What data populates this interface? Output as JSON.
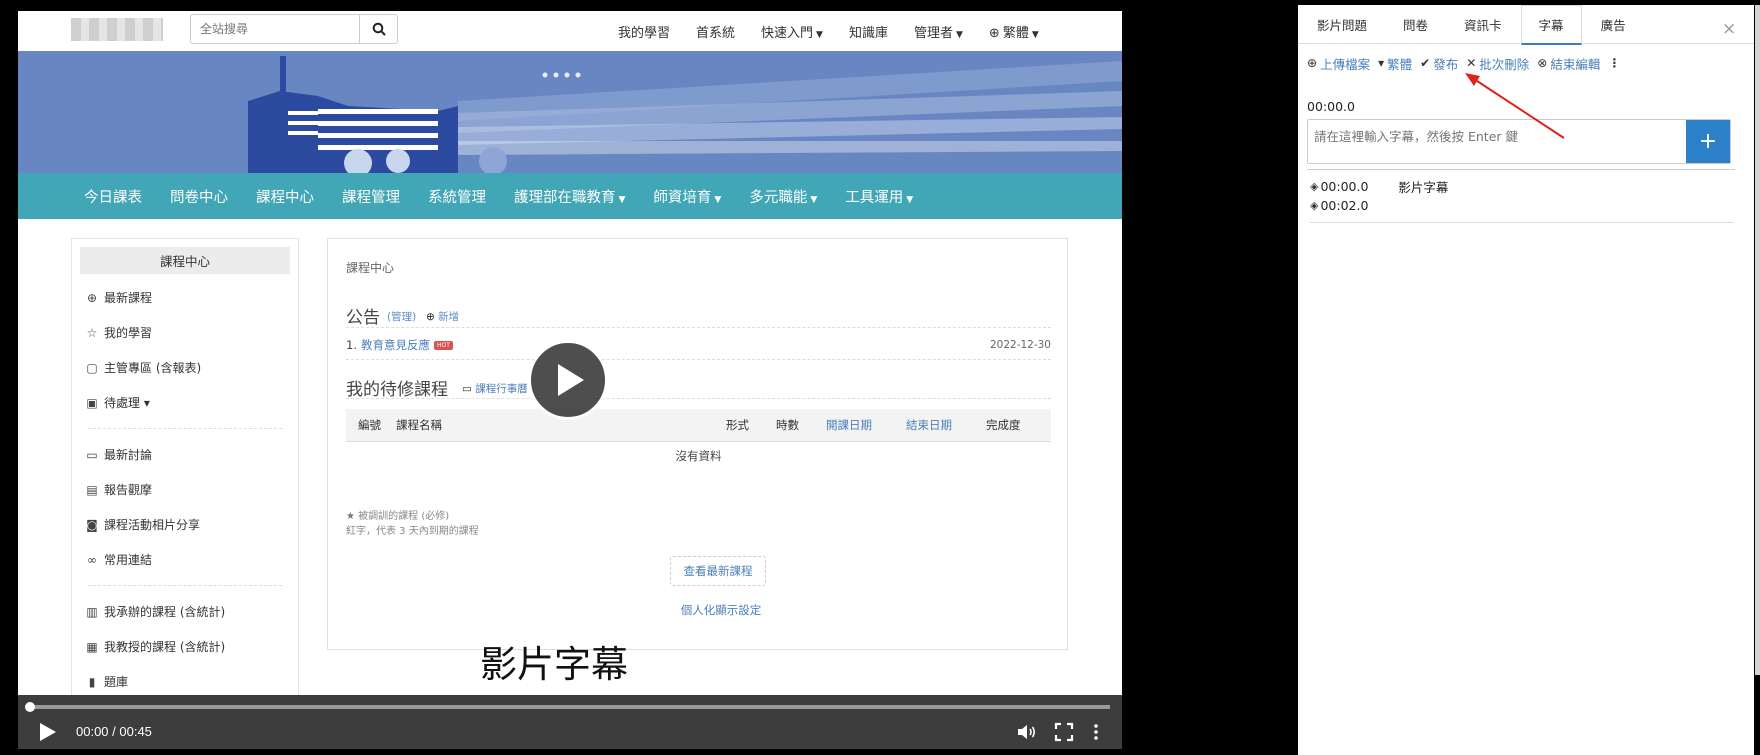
{
  "site": {
    "search_placeholder": "全站搜尋",
    "top_nav": [
      {
        "label": "我的學習",
        "has_caret": false
      },
      {
        "label": "首系統",
        "has_caret": false
      },
      {
        "label": "快速入門",
        "has_caret": true
      },
      {
        "label": "知識庫",
        "has_caret": false
      },
      {
        "label": "管理者",
        "has_caret": true
      },
      {
        "label": "繁體",
        "has_caret": true,
        "globe": true
      }
    ],
    "main_nav": [
      {
        "label": "今日課表",
        "has_caret": false
      },
      {
        "label": "問卷中心",
        "has_caret": false
      },
      {
        "label": "課程中心",
        "has_caret": false
      },
      {
        "label": "課程管理",
        "has_caret": false
      },
      {
        "label": "系統管理",
        "has_caret": false
      },
      {
        "label": "護理部在職教育",
        "has_caret": true
      },
      {
        "label": "師資培育",
        "has_caret": true
      },
      {
        "label": "多元職能",
        "has_caret": true
      },
      {
        "label": "工具運用",
        "has_caret": true
      }
    ],
    "sidebar": {
      "title": "課程中心",
      "groups": [
        [
          {
            "icon": "magnifier-icon",
            "glyph": "⊕",
            "label": "最新課程"
          },
          {
            "icon": "star-icon",
            "glyph": "☆",
            "label": "我的學習"
          },
          {
            "icon": "clipboard-icon",
            "glyph": "▢",
            "label": "主管專區 (含報表)"
          },
          {
            "icon": "briefcase-icon",
            "glyph": "▣",
            "label": "待處理 ▾"
          }
        ],
        [
          {
            "icon": "comment-icon",
            "glyph": "▭",
            "label": "最新討論"
          },
          {
            "icon": "report-icon",
            "glyph": "▤",
            "label": "報告觀摩"
          },
          {
            "icon": "camera-icon",
            "glyph": "◙",
            "label": "課程活動相片分享"
          },
          {
            "icon": "link-icon",
            "glyph": "∞",
            "label": "常用連結"
          }
        ],
        [
          {
            "icon": "files-icon",
            "glyph": "▥",
            "label": "我承辦的課程 (含統計)"
          },
          {
            "icon": "calendar-icon",
            "glyph": "▦",
            "label": "我教授的課程 (含統計)"
          },
          {
            "icon": "books-icon",
            "glyph": "▮",
            "label": "題庫"
          }
        ]
      ]
    },
    "panel": {
      "breadcrumb": "課程中心",
      "announcement_title": "公告",
      "manage_label": "(管理)",
      "new_label": "新增",
      "announcement": {
        "index": "1.",
        "title": "教育意見反應",
        "badge": "HOT",
        "date": "2022-12-30"
      },
      "todo_title": "我的待修課程",
      "calendar_label": "課程行事曆",
      "table_headers": [
        "編號",
        "課程名稱",
        "形式",
        "時數",
        "開課日期",
        "結束日期",
        "完成度"
      ],
      "empty_text": "沒有資料",
      "legend_star": "被調訓的課程 (必修)",
      "legend_red": "紅字，代表 3 天內到期的課程",
      "view_latest": "查看最新課程",
      "personal_settings": "個人化顯示設定"
    }
  },
  "player": {
    "subtitle_overlay": "影片字幕",
    "time_display": "00:00 / 00:45",
    "progress": 0
  },
  "editor": {
    "tabs": [
      {
        "label": "影片問題",
        "active": false
      },
      {
        "label": "問卷",
        "active": false
      },
      {
        "label": "資訊卡",
        "active": false
      },
      {
        "label": "字幕",
        "active": true
      },
      {
        "label": "廣告",
        "active": false
      }
    ],
    "close_glyph": "×",
    "toolbar": {
      "upload": "上傳檔案",
      "language": "繁體",
      "publish": "發布",
      "batch_delete": "批次刪除",
      "end_edit": "結束編輯"
    },
    "current_timecode": "00:00.0",
    "input_placeholder": "請在這裡輸入字幕，然後按 Enter 鍵",
    "add_glyph": "+",
    "cues": [
      {
        "time": "00:00.0",
        "text": "影片字幕"
      },
      {
        "time": "00:02.0",
        "text": ""
      }
    ]
  },
  "colors": {
    "nav_teal": "#41a6b6",
    "banner_blue": "#6887c2",
    "link_blue": "#4a7fbb",
    "add_button_blue": "#2c80c8",
    "arrow_red": "#e0201c"
  }
}
